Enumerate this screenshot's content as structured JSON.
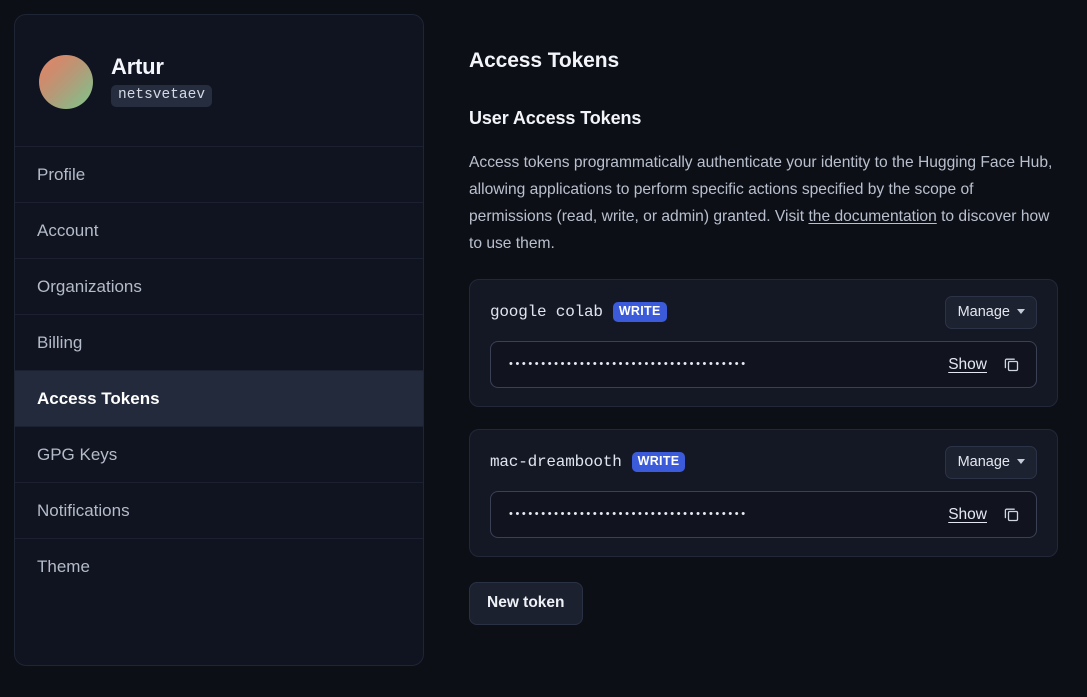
{
  "theme": {
    "page_bg": "#0d0f17",
    "panel_bg": "#101320",
    "card_bg": "#141825",
    "accent_badge": "#3b5bdb",
    "active_nav_bg": "#232a3b"
  },
  "sidebar": {
    "user": {
      "name": "Artur",
      "handle": "netsvetaev"
    },
    "items": [
      {
        "label": "Profile",
        "active": false
      },
      {
        "label": "Account",
        "active": false
      },
      {
        "label": "Organizations",
        "active": false
      },
      {
        "label": "Billing",
        "active": false
      },
      {
        "label": "Access Tokens",
        "active": true
      },
      {
        "label": "GPG Keys",
        "active": false
      },
      {
        "label": "Notifications",
        "active": false
      },
      {
        "label": "Theme",
        "active": false
      }
    ]
  },
  "main": {
    "page_title": "Access Tokens",
    "section_title": "User Access Tokens",
    "description": {
      "part1": "Access tokens programmatically authenticate your identity to the Hugging Face Hub, allowing applications to perform specific actions specified by the scope of permissions (read, write, or admin) granted. Visit ",
      "link_text": "the documentation",
      "part2": " to discover how to use them."
    },
    "tokens": [
      {
        "name": "google colab",
        "scope": "WRITE",
        "manage_label": "Manage",
        "masked_value": "•••••••••••••••••••••••••••••••••••••",
        "show_label": "Show",
        "copy_icon": "copy-icon"
      },
      {
        "name": "mac-dreambooth",
        "scope": "WRITE",
        "manage_label": "Manage",
        "masked_value": "•••••••••••••••••••••••••••••••••••••",
        "show_label": "Show",
        "copy_icon": "copy-icon"
      }
    ],
    "new_token_label": "New token"
  }
}
